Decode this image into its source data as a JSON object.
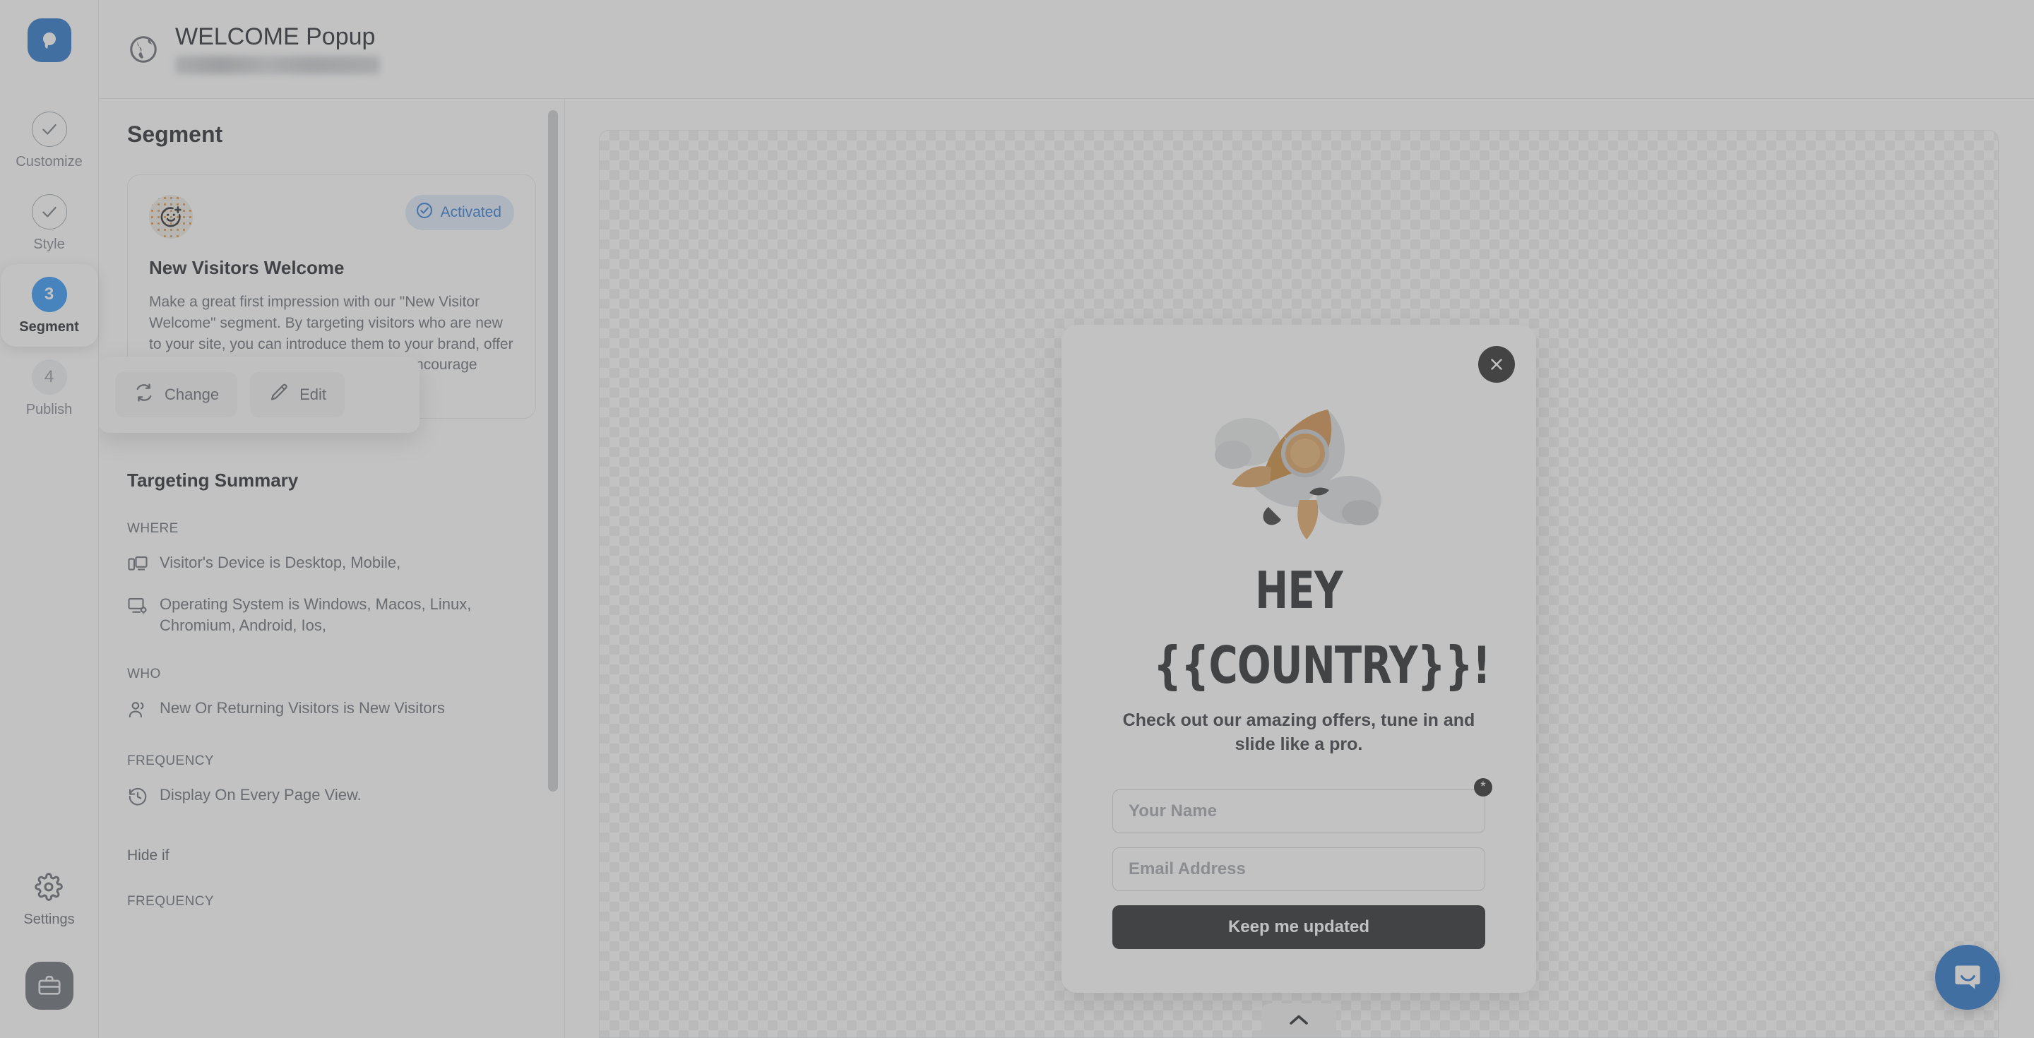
{
  "brand": {
    "logo_icon": "pushengage-logo-icon"
  },
  "header": {
    "globe_icon": "globe-icon",
    "title": "WELCOME Popup",
    "subtitle_blurred": ""
  },
  "rail": {
    "steps": [
      {
        "label": "Customize",
        "marker": "✓",
        "state": "done",
        "icon": "check-circle-icon"
      },
      {
        "label": "Style",
        "marker": "✓",
        "state": "done",
        "icon": "check-circle-icon"
      },
      {
        "label": "Segment",
        "marker": "3",
        "state": "active",
        "icon": "step-number-icon"
      },
      {
        "label": "Publish",
        "marker": "4",
        "state": "upcoming",
        "icon": "step-number-icon"
      }
    ],
    "settings_label": "Settings",
    "settings_icon": "gear-icon",
    "workspace_icon": "briefcase-icon"
  },
  "panel": {
    "heading": "Segment",
    "segment_card": {
      "avatar_icon": "smiley-plus-icon",
      "badge": {
        "label": "Activated",
        "icon": "check-circle-icon",
        "color": "#1c6fd0",
        "background": "#dce8f7"
      },
      "title": "New Visitors Welcome",
      "description": "Make a great first impression with our \"New Visitor Welcome\" segment. By targeting visitors who are new to your site, you can introduce them to your brand, offer them a special welcome incentive, and encourage them to explore your offerings."
    },
    "actions": [
      {
        "label": "Change",
        "icon": "refresh-icon"
      },
      {
        "label": "Edit",
        "icon": "pencil-icon"
      }
    ],
    "targeting": {
      "title": "Targeting Summary",
      "groups": [
        {
          "label": "WHERE",
          "rows": [
            {
              "icon": "devices-icon",
              "text": "Visitor's Device is Desktop, Mobile,"
            },
            {
              "icon": "monitor-gear-icon",
              "text": "Operating System is Windows, Macos, Linux, Chromium, Android, Ios,"
            }
          ]
        },
        {
          "label": "WHO",
          "rows": [
            {
              "icon": "users-icon",
              "text": "New Or Returning Visitors is New Visitors"
            }
          ]
        },
        {
          "label": "FREQUENCY",
          "rows": [
            {
              "icon": "history-icon",
              "text": "Display On Every Page View."
            }
          ]
        }
      ],
      "hide_if_label": "Hide if",
      "hide_if_group_label": "FREQUENCY"
    }
  },
  "preview": {
    "popup": {
      "close_icon": "close-icon",
      "illustration": "rocket-illustration",
      "headline_line1": "HEY",
      "headline_line2": "{{COUNTRY}}!",
      "subheadline": "Check out our amazing offers, tune in and slide like a pro.",
      "fields": [
        {
          "name": "name-field",
          "placeholder": "Your Name",
          "value": "",
          "required_marker": "*"
        },
        {
          "name": "email-field",
          "placeholder": "Email Address",
          "value": ""
        }
      ],
      "submit_label": "Keep me updated"
    },
    "collapse_icon": "chevron-up-icon",
    "support_icon": "chat-bubble-icon"
  }
}
